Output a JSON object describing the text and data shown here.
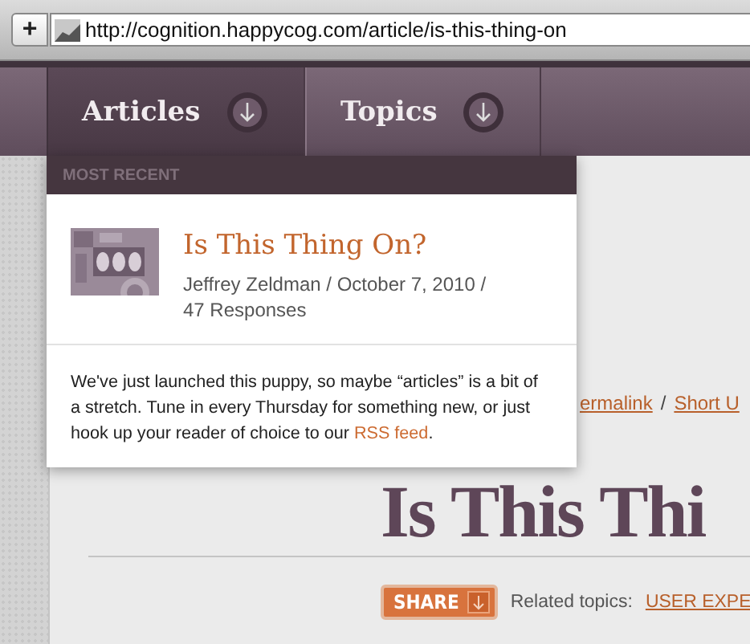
{
  "browser": {
    "add_button": "+",
    "url": "http://cognition.happycog.com/article/is-this-thing-on"
  },
  "nav": {
    "tabs": [
      {
        "label": "Articles",
        "selected": true
      },
      {
        "label": "Topics",
        "selected": false
      }
    ]
  },
  "dropdown": {
    "heading": "MOST RECENT",
    "article": {
      "kind": "picture",
      "title": "Is This Thing On?",
      "byline": "Jeffrey Zeldman / October 7, 2010 /",
      "responses": "47 Responses"
    },
    "intro": {
      "before": "We've just launched this puppy, so maybe “articles” is a bit of a stretch. Tune in every Thursday for something new, or just hook up your reader of choice to our ",
      "link": "RSS feed",
      "after": "."
    }
  },
  "article": {
    "links": [
      "ermalink",
      "Short U"
    ],
    "separator": "/",
    "title": "Is This Thi",
    "share": "SHARE",
    "related_label": "Related topics:",
    "related_link": "USER EXPE"
  }
}
